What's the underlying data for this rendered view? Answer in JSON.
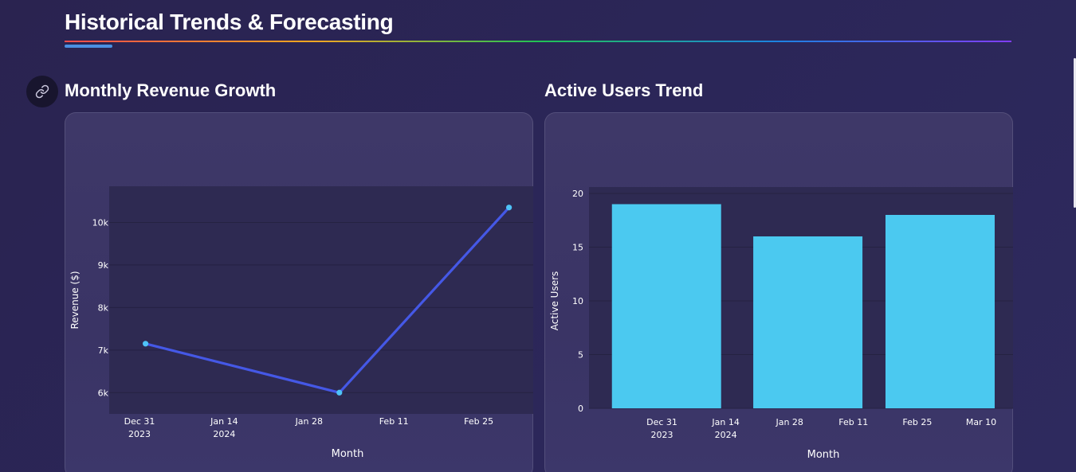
{
  "section": {
    "title": "Historical Trends & Forecasting",
    "link_icon": "link-icon"
  },
  "colors": {
    "line": "#4558e6",
    "marker": "#4fc3f7",
    "bar": "#4bc9f0",
    "plot_bg": "#2e2a52",
    "grid": "#252242",
    "tick": "#ffffff"
  },
  "chart_data": [
    {
      "type": "line",
      "title": "Monthly Revenue Growth",
      "xlabel": "Month",
      "ylabel": "Revenue ($)",
      "x": [
        "2024-01-01",
        "2024-02-02",
        "2024-03-01"
      ],
      "y": [
        7150,
        6000,
        10350
      ],
      "xlim": [
        "2023-12-26",
        "2024-03-05"
      ],
      "ylim": [
        5500,
        10850
      ],
      "yticks": [
        {
          "v": 6000,
          "label": "6k"
        },
        {
          "v": 7000,
          "label": "7k"
        },
        {
          "v": 8000,
          "label": "8k"
        },
        {
          "v": 9000,
          "label": "9k"
        },
        {
          "v": 10000,
          "label": "10k"
        }
      ],
      "xticks": [
        {
          "d": "2023-12-31",
          "label": "Dec 31",
          "sub": "2023"
        },
        {
          "d": "2024-01-14",
          "label": "Jan 14",
          "sub": "2024"
        },
        {
          "d": "2024-01-28",
          "label": "Jan 28",
          "sub": ""
        },
        {
          "d": "2024-02-11",
          "label": "Feb 11",
          "sub": ""
        },
        {
          "d": "2024-02-25",
          "label": "Feb 25",
          "sub": ""
        }
      ],
      "grid": true,
      "markers": true
    },
    {
      "type": "bar",
      "title": "Active Users Trend",
      "xlabel": "Month",
      "ylabel": "Active Users",
      "x": [
        "2024-01-01",
        "2024-02-01",
        "2024-03-01"
      ],
      "values": [
        19,
        16,
        18
      ],
      "xlim": [
        "2023-12-15",
        "2024-03-17"
      ],
      "ylim": [
        0,
        20
      ],
      "yticks": [
        {
          "v": 0,
          "label": "0"
        },
        {
          "v": 5,
          "label": "5"
        },
        {
          "v": 10,
          "label": "10"
        },
        {
          "v": 15,
          "label": "15"
        },
        {
          "v": 20,
          "label": "20"
        }
      ],
      "xticks": [
        {
          "d": "2023-12-31",
          "label": "Dec 31",
          "sub": "2023"
        },
        {
          "d": "2024-01-14",
          "label": "Jan 14",
          "sub": "2024"
        },
        {
          "d": "2024-01-28",
          "label": "Jan 28",
          "sub": ""
        },
        {
          "d": "2024-02-11",
          "label": "Feb 11",
          "sub": ""
        },
        {
          "d": "2024-02-25",
          "label": "Feb 25",
          "sub": ""
        },
        {
          "d": "2024-03-10",
          "label": "Mar 10",
          "sub": ""
        }
      ],
      "grid": true
    }
  ]
}
